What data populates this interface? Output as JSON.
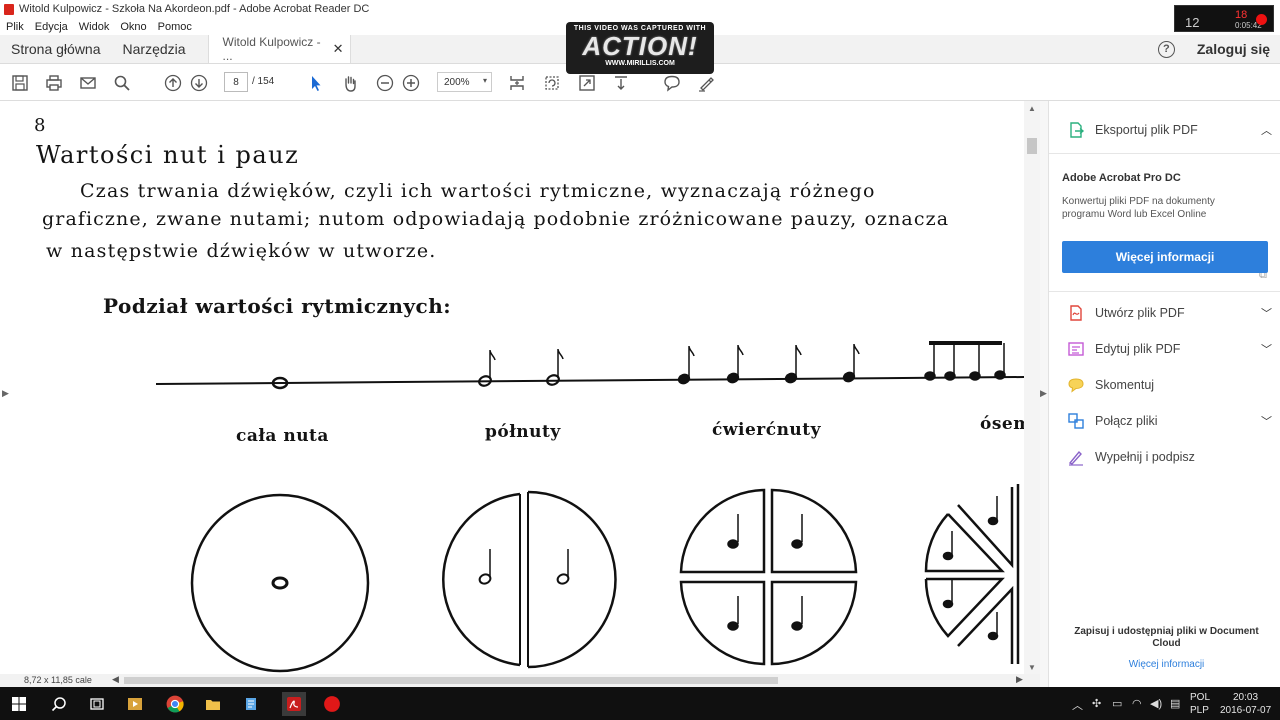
{
  "window": {
    "title": "Witold Kulpowicz - Szkoła Na Akordeon.pdf - Adobe Acrobat Reader DC"
  },
  "menu": [
    "Plik",
    "Edycja",
    "Widok",
    "Okno",
    "Pomoc"
  ],
  "tabs": {
    "home": "Strona główna",
    "tools": "Narzędzia",
    "document": "Witold Kulpowicz - ...",
    "login": "Zaloguj się"
  },
  "toolbar": {
    "page_current": "8",
    "page_total": "/ 154",
    "zoom": "200%"
  },
  "watermark": {
    "line1": "THIS VIDEO WAS CAPTURED WITH",
    "line2": "ACTION!",
    "line3": "WWW.MIRILLIS.COM"
  },
  "recorder": {
    "label": "12",
    "fps": "18",
    "time": "0:05:42"
  },
  "page": {
    "number": "8",
    "title": "Wartości nut i pauz",
    "body_line1": "Czas trwania dźwięków, czyli ich wartości rytmiczne, wyznaczają różnego",
    "body_line2": "graficzne, zwane nutami; nutom odpowiadają podobnie zróżnicowane pauzy, oznacza",
    "body_line3": "w następstwie dźwięków w utworze.",
    "subtitle": "Podział wartości rytmicznych:",
    "labels": [
      "cała nuta",
      "półnuty",
      "ćwierćnuty",
      "ósem"
    ]
  },
  "panel": {
    "export": "Eksportuj plik PDF",
    "product": "Adobe Acrobat Pro DC",
    "description": "Konwertuj pliki PDF na dokumenty programu Word lub Excel Online",
    "more_button": "Więcej informacji",
    "items": [
      {
        "label": "Utwórz plik PDF",
        "color": "#e0463c"
      },
      {
        "label": "Edytuj plik PDF",
        "color": "#c45ad6"
      },
      {
        "label": "Skomentuj",
        "color": "#f2c12e"
      },
      {
        "label": "Połącz pliki",
        "color": "#2d7fdc"
      },
      {
        "label": "Wypełnij i podpisz",
        "color": "#8a63c9"
      }
    ],
    "footer": "Zapisuj i udostępniaj pliki w Document Cloud",
    "footer_link": "Więcej informacji"
  },
  "status": {
    "page_size": "8,72 x 11,85 cale"
  },
  "taskbar": {
    "lang_top": "POL",
    "lang_bottom": "PLP",
    "time": "20:03",
    "date": "2016-07-07"
  },
  "colors": {
    "accent": "#2d7fdc",
    "acrobat_red": "#d9261c"
  }
}
